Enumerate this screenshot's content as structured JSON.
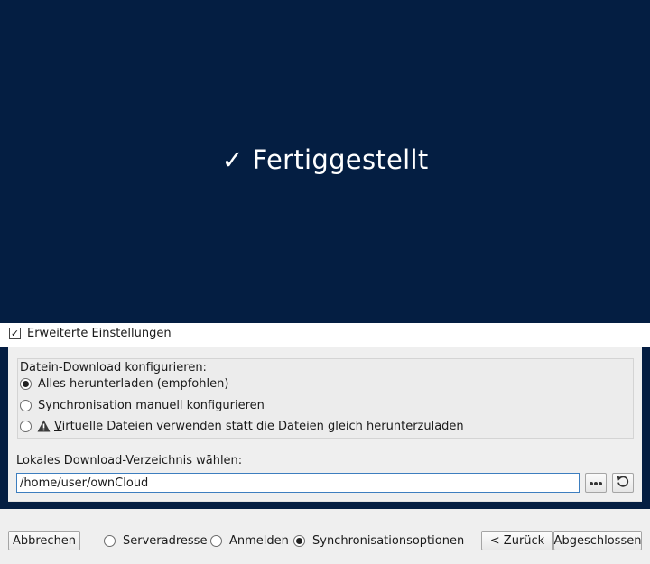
{
  "banner": {
    "check_symbol": "✓",
    "title": "Fertiggestellt"
  },
  "advanced": {
    "label": "Erweiterte Einstellungen",
    "checked": true
  },
  "download_group": {
    "title": "Datein-Download konfigurieren:",
    "options": [
      {
        "label": "Alles herunterladen (empfohlen)",
        "selected": true
      },
      {
        "label": "Synchronisation manuell konfigurieren",
        "selected": false
      },
      {
        "label_first": "V",
        "label_rest": "irtuelle Dateien verwenden statt die Dateien gleich herunterzuladen",
        "selected": false,
        "icon": "warning-icon"
      }
    ]
  },
  "directory": {
    "label": "Lokales Download-Verzeichnis wählen:",
    "value": "/home/user/ownCloud",
    "browse_icon": "ellipsis-icon",
    "reset_icon": "undo-icon"
  },
  "footer": {
    "cancel_label": "Abbrechen",
    "steps": [
      {
        "label": "Serveradresse",
        "selected": false
      },
      {
        "label": "Anmelden",
        "selected": false
      },
      {
        "label": "Synchronisationsoptionen",
        "selected": true
      }
    ],
    "back_label": "< Zurück",
    "finish_label": "Abgeschlossen"
  },
  "colors": {
    "banner_bg": "#041e42",
    "panel_bg": "#efefef",
    "input_focus": "#3d7ebf"
  }
}
